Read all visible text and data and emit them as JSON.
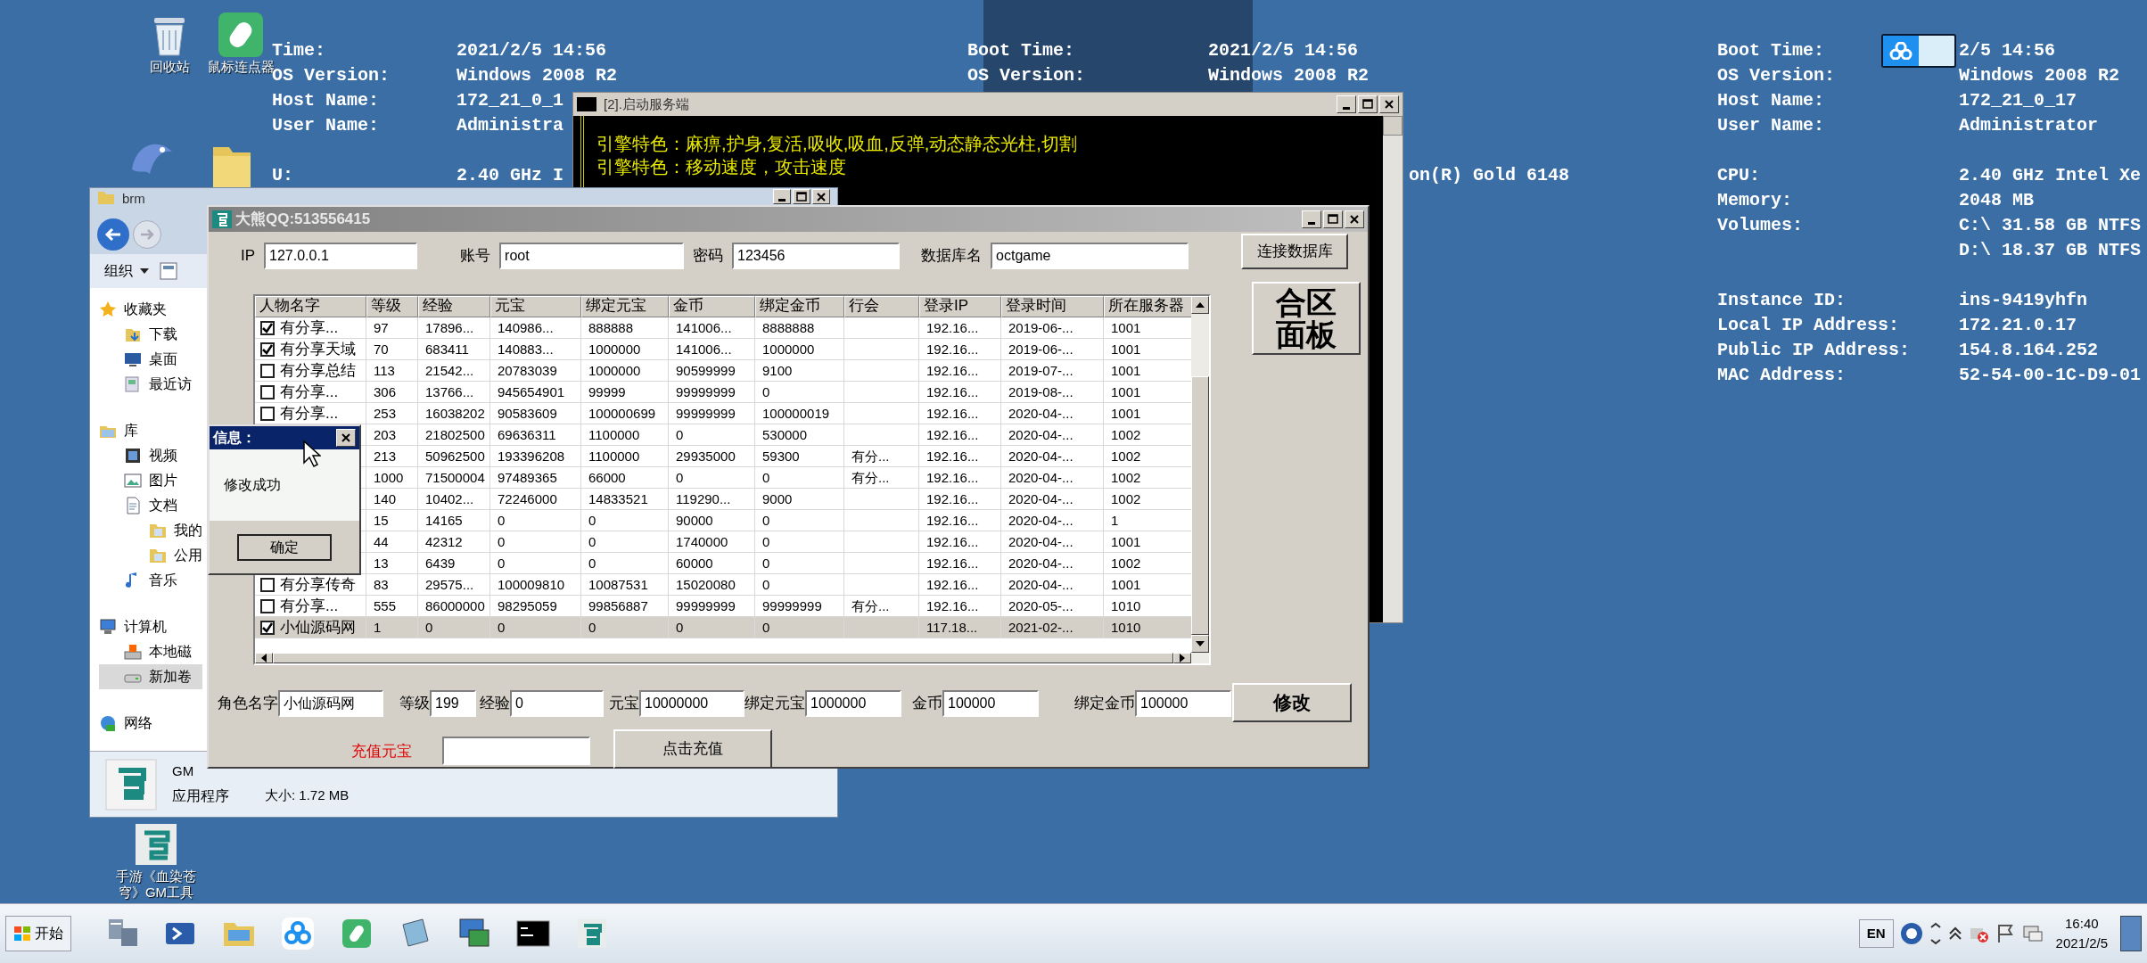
{
  "desktop_icons": [
    {
      "label": "回收站",
      "kind": "recycle"
    },
    {
      "label": "鼠标连点器",
      "kind": "mouse"
    },
    {
      "label": "手游《血染苍穹》GM工具",
      "kind": "gm"
    }
  ],
  "bginfo_left": {
    "groups": [
      [
        {
          "label": "Time:",
          "value": "2021/2/5 14:56"
        },
        {
          "label": "OS Version:",
          "value": "Windows 2008 R2"
        },
        {
          "label": "Host Name:",
          "value": "172_21_0_1"
        },
        {
          "label": "User Name:",
          "value": "Administra"
        }
      ],
      [
        {
          "label": "U:",
          "value": "2.40 GHz I"
        }
      ]
    ]
  },
  "bginfo_middle": {
    "rows": [
      {
        "label": "Boot Time:",
        "value": "2021/2/5 14:56"
      },
      {
        "label": "OS Version:",
        "value": "Windows 2008 R2"
      }
    ],
    "cpu_value_tail": "on(R) Gold 6148"
  },
  "bginfo_right": {
    "groups": [
      [
        {
          "label": "Boot Time:",
          "value": "2/5 14:56"
        },
        {
          "label": "OS Version:",
          "value": "Windows 2008 R2"
        },
        {
          "label": "Host Name:",
          "value": "172_21_0_17"
        },
        {
          "label": "User Name:",
          "value": "Administrator"
        }
      ],
      [
        {
          "label": "CPU:",
          "value": "2.40 GHz Intel Xe"
        },
        {
          "label": "Memory:",
          "value": "2048 MB"
        },
        {
          "label": "Volumes:",
          "value": "C:\\ 31.58 GB NTFS"
        },
        {
          "value": "D:\\ 18.37 GB NTFS"
        }
      ],
      [
        {
          "label": "Instance ID:",
          "value": "ins-9419yhfn"
        },
        {
          "label": "Local IP Address:",
          "value": "172.21.0.17"
        },
        {
          "label": "Public IP Address:",
          "value": "154.8.164.252"
        },
        {
          "label": "MAC Address:",
          "value": "52-54-00-1C-D9-01"
        }
      ]
    ]
  },
  "console": {
    "title": "[2].启动服务端",
    "lines": [
      "引擎特色：麻痹,护身,复活,吸收,吸血,反弹,动态静态光柱,切割",
      "引擎特色：移动速度，攻击速度"
    ]
  },
  "explorer": {
    "title": "brm",
    "toolbar": "组织",
    "nav": [
      {
        "label": "收藏夹",
        "kind": "star",
        "children": [
          {
            "label": "下载",
            "kind": "download",
            "selected": false
          },
          {
            "label": "桌面",
            "kind": "desktop",
            "selected": false
          },
          {
            "label": "最近访",
            "kind": "recent",
            "selected": false
          }
        ]
      },
      {
        "label": "库",
        "kind": "library",
        "children": [
          {
            "label": "视频",
            "kind": "video",
            "selected": false
          },
          {
            "label": "图片",
            "kind": "picture",
            "selected": false
          },
          {
            "label": "文档",
            "kind": "document",
            "selected": false,
            "children": [
              {
                "label": "我的",
                "kind": "folder",
                "selected": false
              },
              {
                "label": "公用",
                "kind": "folder",
                "selected": false
              }
            ]
          },
          {
            "label": "音乐",
            "kind": "music",
            "selected": false
          }
        ]
      },
      {
        "label": "计算机",
        "kind": "computer",
        "children": [
          {
            "label": "本地磁",
            "kind": "disk",
            "selected": false
          },
          {
            "label": "新加卷",
            "kind": "drive",
            "selected": true
          }
        ]
      },
      {
        "label": "网络",
        "kind": "network"
      }
    ],
    "details": {
      "name": "GM",
      "type": "应用程序",
      "size": "大小: 1.72 MB"
    }
  },
  "main_window": {
    "title": "大熊QQ:513556415",
    "connection": [
      {
        "label": "IP",
        "value": "127.0.0.1"
      },
      {
        "label": "账号",
        "value": "root"
      },
      {
        "label": "密码",
        "value": "123456"
      },
      {
        "label": "数据库名",
        "value": "octgame"
      }
    ],
    "connect_button": "连接数据库",
    "merge_button": "合区面板",
    "table": {
      "columns": [
        "人物名字",
        "等级",
        "经验",
        "元宝",
        "绑定元宝",
        "金币",
        "绑定金币",
        "行会",
        "登录IP",
        "登录时间",
        "所在服务器"
      ],
      "rows": [
        {
          "checked": true,
          "selected": false,
          "cells": [
            "有分享...",
            "97",
            "17896...",
            "140986...",
            "888888",
            "141006...",
            "8888888",
            null,
            "192.16...",
            "2019-06-...",
            "1001"
          ]
        },
        {
          "checked": true,
          "selected": false,
          "cells": [
            "有分享天域",
            "70",
            "683411",
            "140883...",
            "1000000",
            "141006...",
            "1000000",
            null,
            "192.16...",
            "2019-06-...",
            "1001"
          ]
        },
        {
          "checked": false,
          "selected": false,
          "cells": [
            "有分享总结",
            "113",
            "21542...",
            "20783039",
            "1000000",
            "90599999",
            "9100",
            null,
            "192.16...",
            "2019-07-...",
            "1001"
          ]
        },
        {
          "checked": false,
          "selected": false,
          "cells": [
            "有分享...",
            "306",
            "13766...",
            "945654901",
            "99999",
            "99999999",
            "0",
            null,
            "192.16...",
            "2019-08-...",
            "1001"
          ]
        },
        {
          "checked": false,
          "selected": false,
          "cells": [
            "有分享...",
            "253",
            "16038202",
            "90583609",
            "100000699",
            "99999999",
            "100000019",
            null,
            "192.16...",
            "2020-04-...",
            "1001"
          ]
        },
        {
          "selected": false,
          "cells": [
            null,
            "203",
            "21802500",
            "69636311",
            "1100000",
            "0",
            "530000",
            null,
            "192.16...",
            "2020-04-...",
            "1002"
          ]
        },
        {
          "selected": false,
          "cells": [
            null,
            "213",
            "50962500",
            "193396208",
            "1100000",
            "29935000",
            "59300",
            "有分...",
            "192.16...",
            "2020-04-...",
            "1002"
          ]
        },
        {
          "selected": false,
          "cells": [
            null,
            "1000",
            "71500004",
            "97489365",
            "66000",
            "0",
            "0",
            "有分...",
            "192.16...",
            "2020-04-...",
            "1002"
          ]
        },
        {
          "selected": false,
          "cells": [
            null,
            "140",
            "10402...",
            "72246000",
            "14833521",
            "119290...",
            "9000",
            null,
            "192.16...",
            "2020-04-...",
            "1002"
          ]
        },
        {
          "selected": false,
          "cells": [
            null,
            "15",
            "14165",
            "0",
            "0",
            "90000",
            "0",
            null,
            "192.16...",
            "2020-04-...",
            "1"
          ]
        },
        {
          "selected": false,
          "cells": [
            null,
            "44",
            "42312",
            "0",
            "0",
            "1740000",
            "0",
            null,
            "192.16...",
            "2020-04-...",
            "1001"
          ]
        },
        {
          "selected": false,
          "cells": [
            null,
            "13",
            "6439",
            "0",
            "0",
            "60000",
            "0",
            null,
            "192.16...",
            "2020-04-...",
            "1002"
          ]
        },
        {
          "checked": false,
          "selected": false,
          "cells": [
            "有分享传奇",
            "83",
            "29575...",
            "100009810",
            "10087531",
            "15020080",
            "0",
            null,
            "192.16...",
            "2020-04-...",
            "1001"
          ]
        },
        {
          "checked": false,
          "selected": false,
          "cells": [
            "有分享...",
            "555",
            "86000000",
            "98295059",
            "99856887",
            "99999999",
            "99999999",
            "有分...",
            "192.16...",
            "2020-05-...",
            "1010"
          ]
        },
        {
          "checked": true,
          "selected": true,
          "cells": [
            "小仙源码网",
            "1",
            "0",
            "0",
            "0",
            "0",
            "0",
            null,
            "117.18...",
            "2021-02-...",
            "1010"
          ]
        }
      ]
    },
    "edit_form": [
      {
        "label": "角色名字",
        "value": "小仙源码网"
      },
      {
        "label": "等级",
        "value": "199"
      },
      {
        "label": "经验",
        "value": "0"
      },
      {
        "label": "元宝",
        "value": "10000000"
      },
      {
        "label": "绑定元宝",
        "value": "1000000"
      },
      {
        "label": "金币",
        "value": "100000"
      },
      {
        "label": "绑定金币",
        "value": "100000"
      }
    ],
    "edit_button": "修改",
    "recharge_label": "充值元宝",
    "recharge_button": "点击充值"
  },
  "dialog": {
    "title": "信息：",
    "message": "修改成功",
    "ok_button": "确定"
  },
  "taskbar": {
    "start": "开始",
    "apps": [
      {
        "kind": "server"
      },
      {
        "kind": "powershell"
      },
      {
        "kind": "explorer"
      },
      {
        "kind": "cloud"
      },
      {
        "kind": "mouse"
      },
      {
        "kind": "notepad"
      },
      {
        "kind": "network"
      },
      {
        "kind": "console"
      },
      {
        "kind": "gm"
      }
    ],
    "language": "EN",
    "time": "16:40",
    "date": "2021/2/5"
  }
}
